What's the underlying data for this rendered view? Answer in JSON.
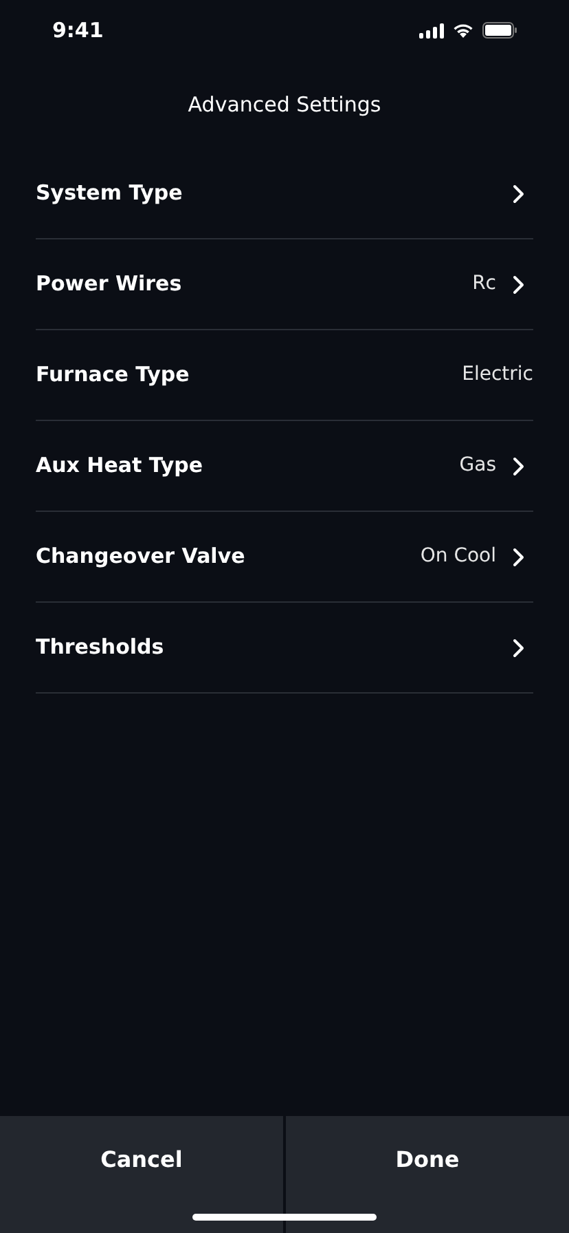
{
  "status_bar": {
    "time": "9:41"
  },
  "title": "Advanced Settings",
  "rows": [
    {
      "label": "System Type",
      "kind": "link"
    },
    {
      "label": "Power Wires",
      "value": "Rc",
      "kind": "link"
    },
    {
      "label": "Furnace Type",
      "value": "Electric",
      "kind": "info"
    },
    {
      "label": "Aux Heat Type",
      "value": "Gas",
      "kind": "link"
    },
    {
      "label": "Changeover Valve",
      "value": "On Cool",
      "kind": "link"
    },
    {
      "label": "Thresholds",
      "kind": "link"
    }
  ],
  "buttons": [
    "Cancel",
    "Done"
  ]
}
